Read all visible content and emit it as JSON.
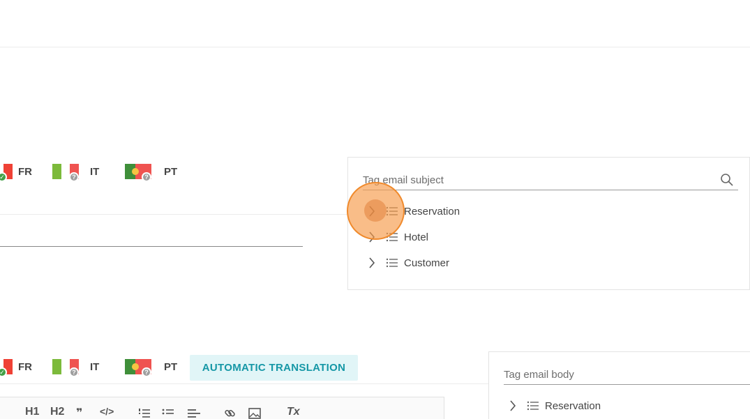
{
  "languages_subject": [
    {
      "code": "FR",
      "status": "translated"
    },
    {
      "code": "IT",
      "status": "missing"
    },
    {
      "code": "PT",
      "status": "missing"
    }
  ],
  "languages_body": [
    {
      "code": "FR",
      "status": "translated"
    },
    {
      "code": "IT",
      "status": "missing"
    },
    {
      "code": "PT",
      "status": "missing"
    }
  ],
  "badges": {
    "missing": "?",
    "translated": "✓"
  },
  "subject_tags": {
    "placeholder": "Tag email subject",
    "items": [
      "Reservation",
      "Hotel",
      "Customer"
    ]
  },
  "body_tags": {
    "placeholder": "Tag email body",
    "items": [
      "Reservation"
    ]
  },
  "auto_translation_label": "AUTOMATIC TRANSLATION",
  "toolbar": {
    "h1": "H1",
    "h2": "H2",
    "quote": "❞",
    "code": "</>",
    "clear_format": "Tx"
  },
  "colors": {
    "accent": "#1597a6",
    "accent_bg": "#e1f5f7",
    "click_highlight": "#f08a2c"
  }
}
